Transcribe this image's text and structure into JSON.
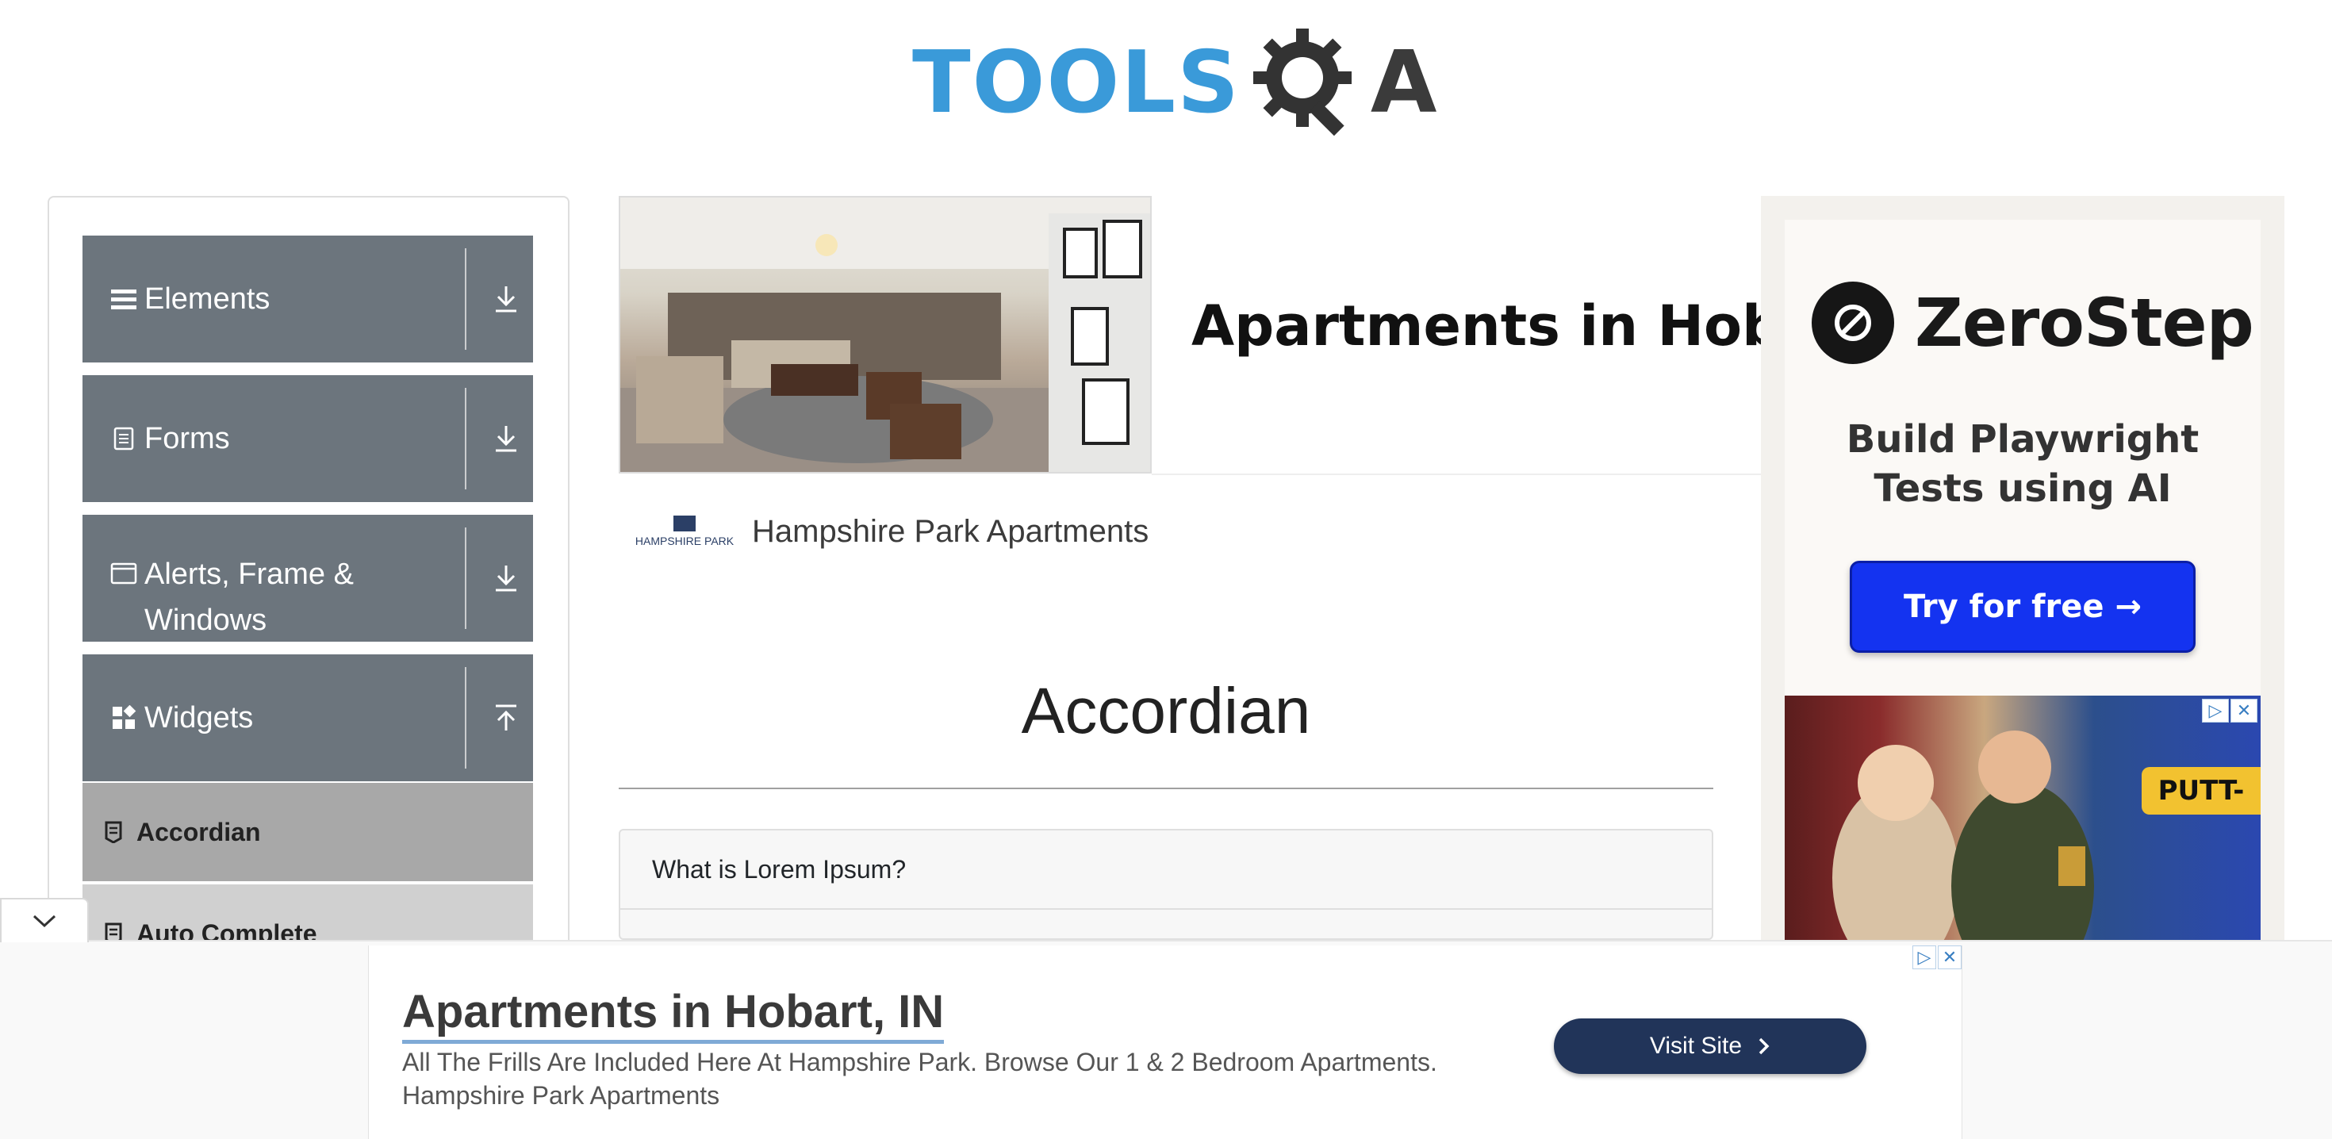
{
  "header": {
    "logo_text": "TOOLS",
    "logo_suffix": "A",
    "logo_brand_color": "#3a9ad9"
  },
  "sidebar": {
    "groups": [
      {
        "label": "Elements",
        "icon": "hamburger-icon",
        "arrow": "download-arrow-icon"
      },
      {
        "label": "Forms",
        "icon": "document-icon",
        "arrow": "download-arrow-icon"
      },
      {
        "label": "Alerts, Frame & Windows",
        "icon": "window-icon",
        "arrow": "download-arrow-icon"
      },
      {
        "label": "Widgets",
        "icon": "widgets-icon",
        "arrow": "upload-arrow-icon"
      }
    ],
    "sub_items": [
      {
        "label": "Accordian",
        "icon": "file-icon",
        "active": true
      },
      {
        "label": "Auto Complete",
        "icon": "file-icon",
        "active": false
      }
    ],
    "group_color": "#6c757d"
  },
  "banner_ad": {
    "headline": "Apartments in Hobart,",
    "advertiser_logo_text": "HAMPSHIRE PARK",
    "advertiser_name": "Hampshire Park Apartments"
  },
  "main": {
    "page_title": "Accordian",
    "accordion": [
      {
        "heading": "What is Lorem Ipsum?"
      }
    ]
  },
  "right_ad": {
    "brand": "ZeroStep",
    "tagline_line1": "Build Playwright",
    "tagline_line2": "Tests using AI",
    "cta": "Try for free →",
    "cta_color": "#1433f0",
    "photo_sign": "PUTT-"
  },
  "bottom_ad": {
    "title": "Apartments in Hobart, IN",
    "description": "All The Frills Are Included Here At Hampshire Park. Browse Our 1 & 2 Bedroom Apartments.",
    "advertiser": "Hampshire Park Apartments",
    "cta": "Visit Site",
    "cta_color": "#213459"
  }
}
